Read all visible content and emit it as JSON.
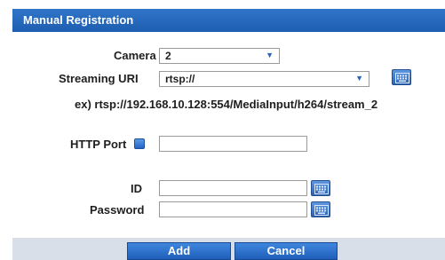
{
  "dialog": {
    "title": "Manual Registration"
  },
  "fields": {
    "camera": {
      "label": "Camera",
      "value": "2"
    },
    "streaming_uri": {
      "label": "Streaming URI",
      "value": "rtsp://"
    },
    "example": "ex) rtsp://192.168.10.128:554/MediaInput/h264/stream_2",
    "http_port": {
      "label": "HTTP Port",
      "value": ""
    },
    "id": {
      "label": "ID",
      "value": ""
    },
    "password": {
      "label": "Password",
      "value": ""
    }
  },
  "buttons": {
    "add": "Add",
    "cancel": "Cancel"
  },
  "icons": {
    "dropdown": "chevron-down-icon",
    "keyboard": "keyboard-icon",
    "checkbox": "checkbox-icon"
  },
  "colors": {
    "title_bar": "#2467bd",
    "button": "#2a6fcc",
    "footer": "#d9dfe8"
  }
}
